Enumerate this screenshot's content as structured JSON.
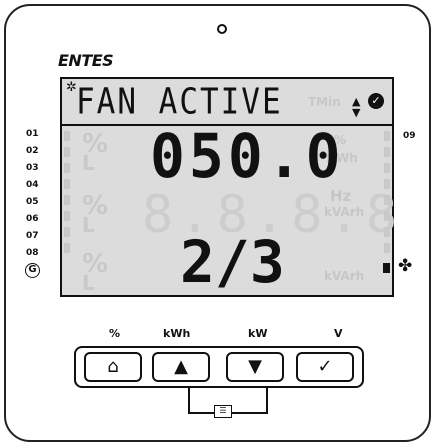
{
  "brand": "ENTES",
  "display": {
    "status_text": "FAN ACTIVE",
    "main_value": "050.0",
    "step_value": "2/3",
    "ghost_digits": "8.8.8.8",
    "ghost_units": [
      "%",
      "L",
      "Hz",
      "%Wh",
      "kVArh"
    ]
  },
  "channels": [
    "01",
    "02",
    "03",
    "04",
    "05",
    "06",
    "07",
    "08"
  ],
  "channel_right": "09",
  "ground_icon_label": "G",
  "buttons": [
    {
      "label": "%",
      "icon": "home-icon",
      "glyph": "⌂"
    },
    {
      "label": "kWh",
      "icon": "up-triangle-icon",
      "glyph": "▲"
    },
    {
      "label": "kW",
      "icon": "down-triangle-icon",
      "glyph": "▼"
    },
    {
      "label": "V",
      "icon": "check-circle-icon",
      "glyph": "✓"
    }
  ],
  "icons": {
    "gear": "gear-icon",
    "updown": "up-down-arrows-icon",
    "check": "check-circle-icon",
    "fan": "fan-icon",
    "menu": "menu-icon"
  }
}
